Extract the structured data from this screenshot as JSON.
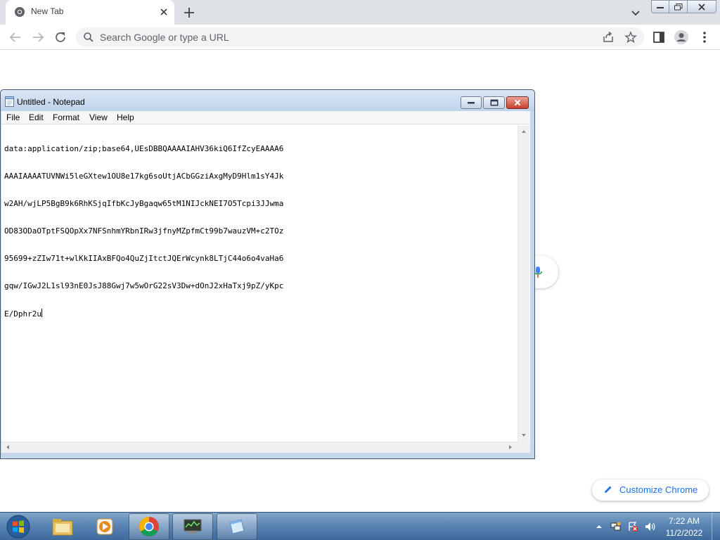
{
  "browser": {
    "tab_title": "New Tab",
    "omnibox_placeholder": "Search Google or type a URL",
    "customize_label": "Customize Chrome",
    "icons": [
      "chrome-icon",
      "close-icon",
      "plus-icon",
      "chevron-down-icon",
      "back-arrow-icon",
      "forward-arrow-icon",
      "reload-icon",
      "search-icon",
      "share-icon",
      "star-icon",
      "side-panel-icon",
      "profile-icon",
      "more-vert-icon",
      "microphone-icon",
      "pencil-icon"
    ]
  },
  "notepad": {
    "title": "Untitled - Notepad",
    "menu": [
      "File",
      "Edit",
      "Format",
      "View",
      "Help"
    ],
    "lines": [
      "data:application/zip;base64,UEsDBBQAAAAIAHV36kiQ6IfZcyEAAAA6",
      "AAAIAAAATUVNWi5leGXtew1OU8e17kg6soUtjACbGGziAxgMyD9Hlm1sY4Jk",
      "w2AH/wjLP5BgB9k6RhKSjqIfbKcJyBgaqw65tM1NIJckNEI7O5Tcpi3JJwma",
      "OD83ODaOTptFSQOpXx7NFSnhmYRbnIRw3jfnyMZpfmCt99b7wauzVM+c2TOz",
      "95699+zZIw71t+wlKkIIAxBFQo4QuZjItctJQErWcynk8LTjC44o6o4vaHa6",
      "gqw/IGwJ2L1sl93nE0JsJ88Gwj7w5wOrG22sV3Dw+dOnJ2xHaTxj9pZ/yKpc",
      "E/Dphr2u"
    ]
  },
  "taskbar": {
    "clock_time": "7:22 AM",
    "clock_date": "11/2/2022",
    "apps": [
      "windows-explorer",
      "media-player",
      "google-chrome",
      "network-tool",
      "notepad"
    ]
  },
  "colors": {
    "chrome_tabstrip": "#dee1e6",
    "link_blue": "#1a73e8",
    "taskbar": "#5a84b3",
    "notepad_frame": "#c6d7ec"
  }
}
